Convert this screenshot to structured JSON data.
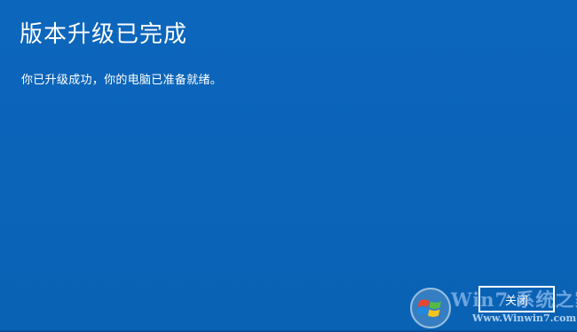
{
  "dialog": {
    "title": "版本升级已完成",
    "message": "你已升级成功，你的电脑已准备就绪。",
    "close_label": "关闭"
  },
  "watermark": {
    "text": "Win7 系统之家",
    "url": "Www.Winwin7.com"
  },
  "colors": {
    "background": "#0b64b8",
    "text": "#ffffff",
    "button_border": "#ffffff"
  }
}
